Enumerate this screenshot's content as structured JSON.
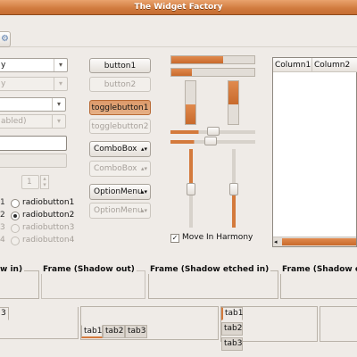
{
  "window": {
    "title": "The Widget Factory"
  },
  "toolbar": {
    "icon": "gear-icon"
  },
  "combos": [
    {
      "text": "y",
      "disabled": false
    },
    {
      "text": "y",
      "disabled": true
    },
    {
      "text": "",
      "disabled": false
    },
    {
      "text": "abled)",
      "disabled": true
    }
  ],
  "spinner": {
    "value": "1"
  },
  "radios": [
    {
      "left_number": "1",
      "label": "radiobutton1",
      "checked": false,
      "disabled": false
    },
    {
      "left_number": "2",
      "label": "radiobutton2",
      "checked": true,
      "disabled": false
    },
    {
      "left_number": "3",
      "label": "radiobutton3",
      "checked": false,
      "disabled": true
    },
    {
      "left_number": "4",
      "label": "radiobutton4",
      "checked": false,
      "disabled": true
    }
  ],
  "buttons": {
    "button1": "button1",
    "button2": "button2",
    "toggle1": "togglebutton1",
    "toggle2": "togglebutton2",
    "combo1": "ComboBox",
    "combo2": "ComboBox",
    "option1": "OptionMenu",
    "option2": "OptionMenu"
  },
  "harmony": {
    "label": "Move In Harmony",
    "checked": true
  },
  "levels": {
    "hbar1": 0.62,
    "hbar2": 0.25,
    "vbar1": 0.45,
    "vbar2": 0.55,
    "hscale1": 0.33,
    "hscale2": 0.28,
    "vscale1": 0.49,
    "vscale2": 0.49
  },
  "tree": {
    "columns": [
      "Column1",
      "Column2"
    ]
  },
  "frames": [
    {
      "label": "w in)"
    },
    {
      "label": "Frame (Shadow out)"
    },
    {
      "label": "Frame (Shadow etched in)"
    },
    {
      "label": "Frame (Shadow e"
    }
  ],
  "tabs": {
    "left": [
      "3"
    ],
    "bottom": [
      "tab1",
      "tab2",
      "tab3"
    ],
    "right": [
      "tab1",
      "tab2",
      "tab3"
    ]
  },
  "colors": {
    "accent": "#d47a3c",
    "background": "#efebe7"
  }
}
